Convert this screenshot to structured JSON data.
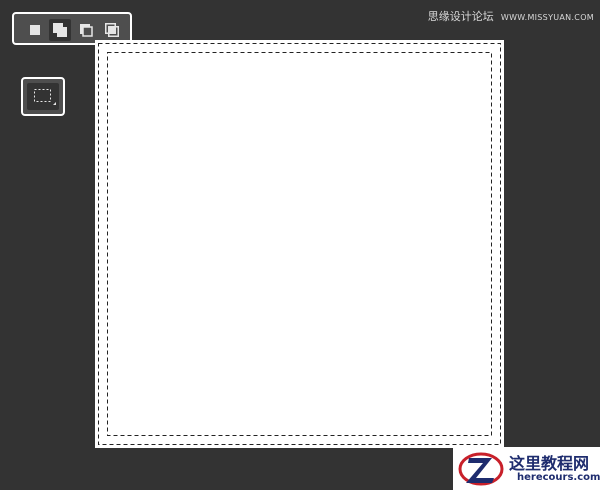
{
  "toolbar": {
    "modes": [
      {
        "name": "new-selection",
        "icon": "new-selection-icon",
        "active": false
      },
      {
        "name": "add-to-selection",
        "icon": "add-to-selection-icon",
        "active": true
      },
      {
        "name": "subtract-from-selection",
        "icon": "subtract-from-selection-icon",
        "active": false
      },
      {
        "name": "intersect-with-selection",
        "icon": "intersect-with-selection-icon",
        "active": false
      }
    ]
  },
  "tool": {
    "name": "rectangular-marquee-tool",
    "icon": "rectangular-marquee-icon"
  },
  "watermark": {
    "cn": "思缘设计论坛",
    "url": "WWW.MISSYUAN.COM",
    "logo_cn": "这里教程网",
    "logo_en": "herecours.com"
  },
  "colors": {
    "background": "#333333",
    "toolbar": "#4e4e4e",
    "canvas": "#ffffff",
    "logo_blue": "#1e2c6e",
    "logo_red": "#c8202a"
  }
}
